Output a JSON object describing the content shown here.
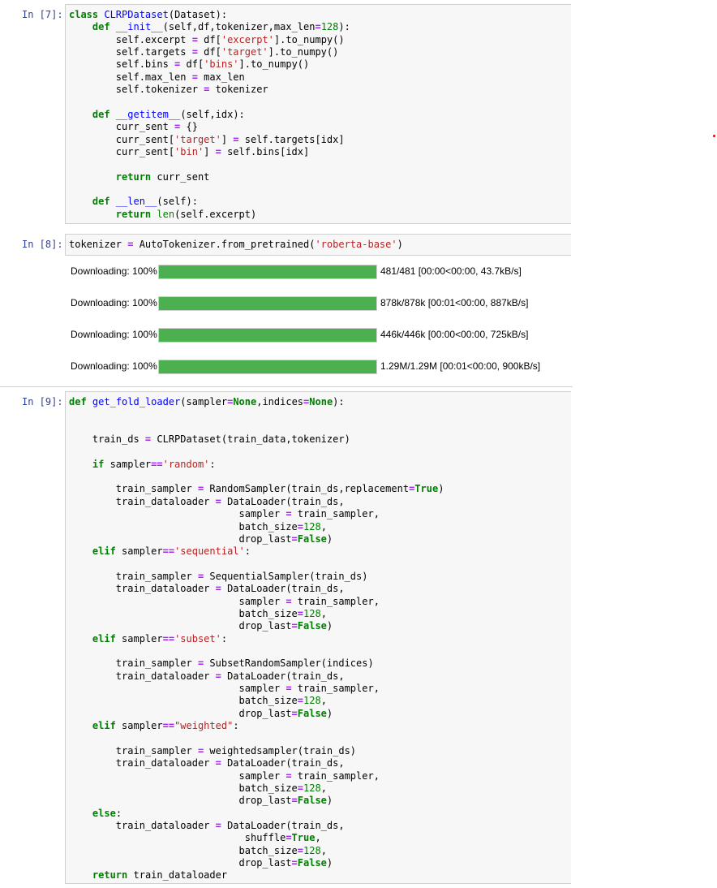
{
  "cells": [
    {
      "prompt": "In [7]:",
      "lines": [
        "class CLRPDataset(Dataset):",
        "    def __init__(self,df,tokenizer,max_len=128):",
        "        self.excerpt = df['excerpt'].to_numpy()",
        "        self.targets = df['target'].to_numpy()",
        "        self.bins = df['bins'].to_numpy()",
        "        self.max_len = max_len",
        "        self.tokenizer = tokenizer",
        "",
        "    def __getitem__(self,idx):",
        "        curr_sent = {}",
        "        curr_sent['target'] = self.targets[idx]",
        "        curr_sent['bin'] = self.bins[idx]",
        "",
        "        return curr_sent",
        "",
        "    def __len__(self):",
        "        return len(self.excerpt)"
      ]
    },
    {
      "prompt": "In [8]:",
      "lines": [
        "tokenizer = AutoTokenizer.from_pretrained('roberta-base')"
      ],
      "outputs": [
        {
          "label": "Downloading: 100%",
          "progress": 1.0,
          "info": "481/481 [00:00<00:00, 43.7kB/s]"
        },
        {
          "label": "Downloading: 100%",
          "progress": 1.0,
          "info": "878k/878k [00:01<00:00, 887kB/s]"
        },
        {
          "label": "Downloading: 100%",
          "progress": 1.0,
          "info": "446k/446k [00:00<00:00, 725kB/s]"
        },
        {
          "label": "Downloading: 100%",
          "progress": 1.0,
          "info": "1.29M/1.29M [00:01<00:00, 900kB/s]"
        }
      ]
    },
    {
      "prompt": "In [9]:",
      "lines": [
        "def get_fold_loader(sampler=None,indices=None):",
        "",
        "",
        "    train_ds = CLRPDataset(train_data,tokenizer)",
        "",
        "    if sampler=='random':",
        "",
        "        train_sampler = RandomSampler(train_ds,replacement=True)",
        "        train_dataloader = DataLoader(train_ds,",
        "                             sampler = train_sampler,",
        "                             batch_size=128,",
        "                             drop_last=False)",
        "    elif sampler=='sequential':",
        "",
        "        train_sampler = SequentialSampler(train_ds)",
        "        train_dataloader = DataLoader(train_ds,",
        "                             sampler = train_sampler,",
        "                             batch_size=128,",
        "                             drop_last=False)",
        "    elif sampler=='subset':",
        "",
        "        train_sampler = SubsetRandomSampler(indices)",
        "        train_dataloader = DataLoader(train_ds,",
        "                             sampler = train_sampler,",
        "                             batch_size=128,",
        "                             drop_last=False)",
        "    elif sampler==\"weighted\":",
        "",
        "        train_sampler = weightedsampler(train_ds)",
        "        train_dataloader = DataLoader(train_ds,",
        "                             sampler = train_sampler,",
        "                             batch_size=128,",
        "                             drop_last=False)",
        "    else:",
        "        train_dataloader = DataLoader(train_ds,",
        "                              shuffle=True,",
        "                             batch_size=128,",
        "                             drop_last=False)",
        "    return train_dataloader"
      ]
    }
  ],
  "colors": {
    "keyword": "#008000",
    "definition": "#0000ff",
    "string": "#ba2121",
    "prompt": "#303f9f",
    "progress_fill": "#4caf50"
  }
}
